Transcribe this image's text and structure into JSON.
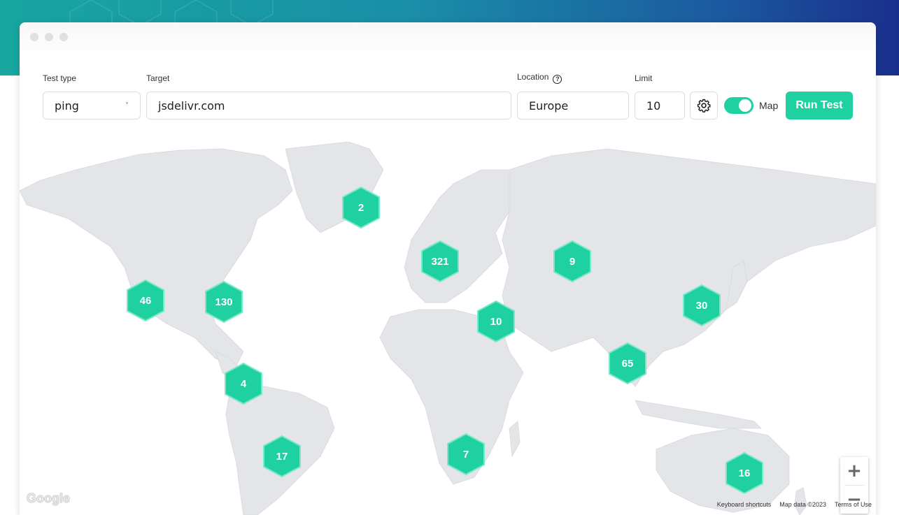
{
  "form": {
    "test_type_label": "Test type",
    "test_type_value": "ping",
    "target_label": "Target",
    "target_value": "jsdelivr.com",
    "location_label": "Location",
    "location_value": "Europe",
    "limit_label": "Limit",
    "limit_value": "10",
    "map_toggle_label": "Map",
    "map_toggle_on": true,
    "run_label": "Run Test"
  },
  "map": {
    "clusters": [
      "2",
      "321",
      "9",
      "46",
      "130",
      "10",
      "30",
      "65",
      "4",
      "17",
      "7",
      "16"
    ],
    "zoom_in": "+",
    "zoom_out": "−",
    "logo": "Google",
    "attribution": {
      "shortcuts": "Keyboard shortcuts",
      "data": "Map data ©2023",
      "terms": "Terms of Use"
    }
  },
  "colors": {
    "accent": "#1fd1a0",
    "land": "#e3e5e8"
  }
}
